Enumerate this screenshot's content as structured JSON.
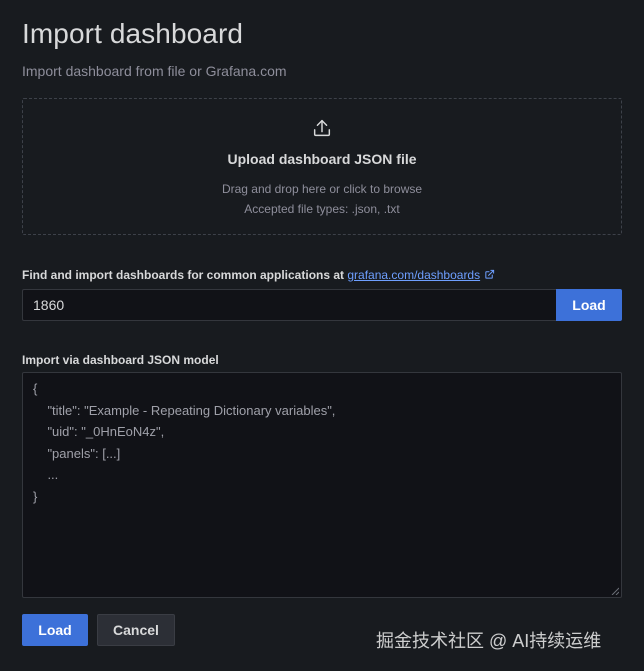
{
  "header": {
    "title": "Import dashboard",
    "subtitle": "Import dashboard from file or Grafana.com"
  },
  "upload": {
    "icon": "upload-icon",
    "title": "Upload dashboard JSON file",
    "hint": "Drag and drop here or click to browse",
    "accepted_types": "Accepted file types: .json, .txt"
  },
  "find": {
    "label": "Find and import dashboards for common applications at ",
    "link_text": "grafana.com/dashboards",
    "link_icon": "external-link-icon",
    "input_value": "1860",
    "load_label": "Load"
  },
  "json_model": {
    "label": "Import via dashboard JSON model",
    "lines": [
      "{",
      "    \"title\": \"Example - Repeating Dictionary variables\",",
      "    \"uid\": \"_0HnEoN4z\",",
      "    \"panels\": [...]",
      "    ...",
      "}"
    ]
  },
  "footer": {
    "load_label": "Load",
    "cancel_label": "Cancel"
  },
  "watermark": "掘金技术社区 @ AI持续运维",
  "colors": {
    "background": "#181b1f",
    "primary": "#3d71d9",
    "link": "#6e9fff"
  }
}
